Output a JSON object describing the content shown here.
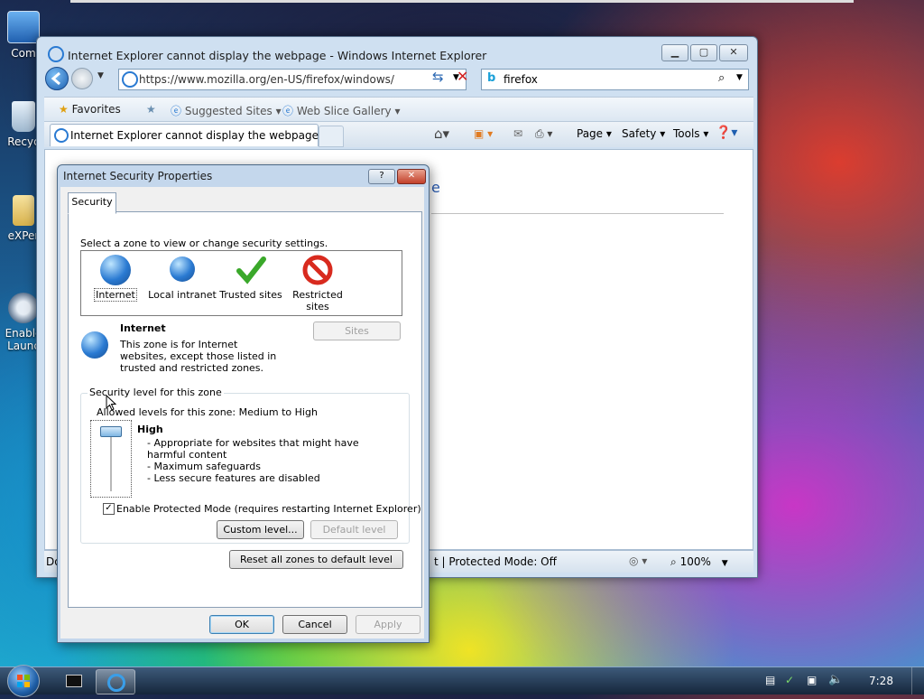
{
  "desktop": {
    "icons": [
      {
        "label": "Com"
      },
      {
        "label": "Recyc"
      },
      {
        "label": "eXPer"
      },
      {
        "label": "Enable"
      },
      {
        "label": "Launc"
      }
    ]
  },
  "ie": {
    "title": "Internet Explorer cannot display the webpage - Windows Internet Explorer",
    "address": "https://www.mozilla.org/en-US/firefox/windows/",
    "search_query": "firefox",
    "favorites_label": "Favorites",
    "suggested_sites": "Suggested Sites",
    "web_slice_gallery": "Web Slice Gallery",
    "tab_title": "Internet Explorer cannot display the webpage",
    "menu": {
      "page": "Page",
      "safety": "Safety",
      "tools": "Tools"
    },
    "content_fragment": "e",
    "status_left": "Do",
    "status_mode": "t | Protected Mode: Off",
    "zoom": "100%"
  },
  "dialog": {
    "title": "Internet Security Properties",
    "tab": "Security",
    "instruction": "Select a zone to view or change security settings.",
    "zones": [
      {
        "label": "Internet"
      },
      {
        "label": "Local intranet"
      },
      {
        "label": "Trusted sites"
      },
      {
        "label": "Restricted sites"
      }
    ],
    "zone_name": "Internet",
    "zone_description": "This zone is for Internet websites, except those listed in trusted and restricted zones.",
    "sites_button": "Sites",
    "group_legend": "Security level for this zone",
    "allowed_levels": "Allowed levels for this zone: Medium to High",
    "level_name": "High",
    "level_desc": [
      "- Appropriate for websites that might have harmful content",
      "- Maximum safeguards",
      "- Less secure features are disabled"
    ],
    "protected_mode_label": "Enable Protected Mode (requires restarting Internet Explorer)",
    "protected_mode_checked": true,
    "custom_level": "Custom level...",
    "default_level": "Default level",
    "reset_all": "Reset all zones to default level",
    "ok": "OK",
    "cancel": "Cancel",
    "apply": "Apply"
  },
  "taskbar": {
    "clock": "7:28"
  }
}
